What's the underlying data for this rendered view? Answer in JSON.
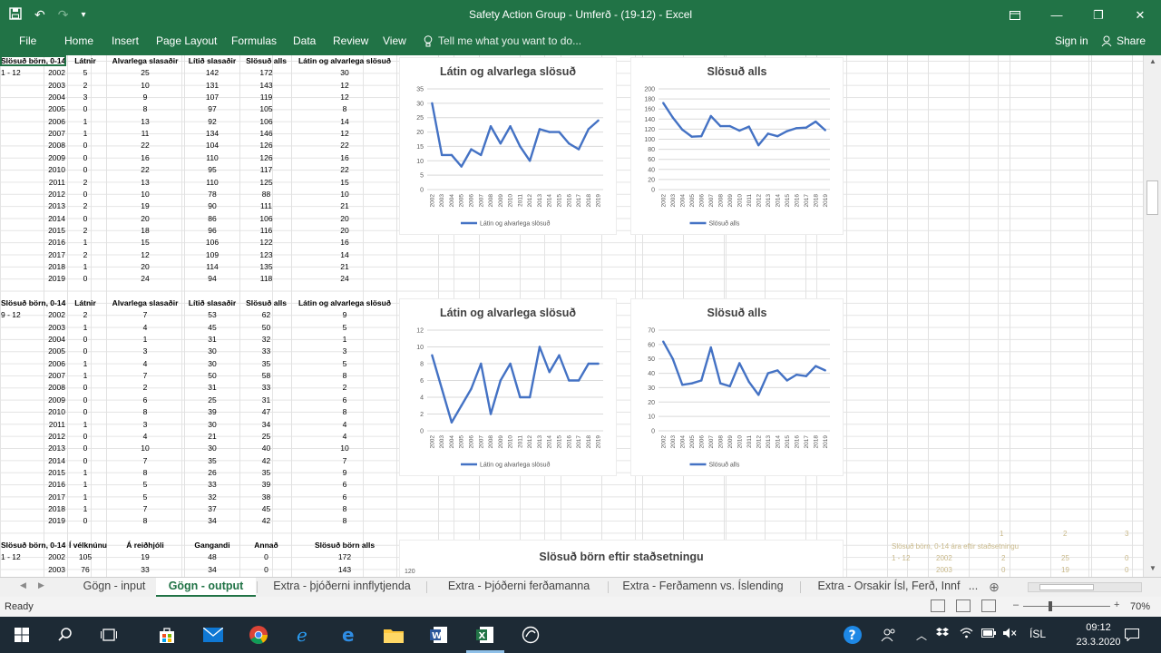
{
  "window": {
    "title": "Safety Action Group - Umferð - (19-12) - Excel",
    "minimize": "—",
    "restore": "❐",
    "close": "✕"
  },
  "qat": {
    "save": "💾",
    "undo": "↶",
    "redo": "↷",
    "more": "▾"
  },
  "ribbon": {
    "tabs": [
      "File",
      "Home",
      "Insert",
      "Page Layout",
      "Formulas",
      "Data",
      "Review",
      "View"
    ],
    "tell_me": "Tell me what you want to do...",
    "sign_in": "Sign in",
    "share": "Share"
  },
  "tables": [
    {
      "headers": [
        "Slösuð börn, 0-14",
        "",
        "Látnir",
        "Alvarlega slasaðir",
        "Lítið slasaðir",
        "Slösuð alls",
        "Látin og alvarlega slösuð"
      ],
      "age": "1 - 12",
      "rows": [
        [
          "2002",
          "5",
          "25",
          "142",
          "172",
          "30"
        ],
        [
          "2003",
          "2",
          "10",
          "131",
          "143",
          "12"
        ],
        [
          "2004",
          "3",
          "9",
          "107",
          "119",
          "12"
        ],
        [
          "2005",
          "0",
          "8",
          "97",
          "105",
          "8"
        ],
        [
          "2006",
          "1",
          "13",
          "92",
          "106",
          "14"
        ],
        [
          "2007",
          "1",
          "11",
          "134",
          "146",
          "12"
        ],
        [
          "2008",
          "0",
          "22",
          "104",
          "126",
          "22"
        ],
        [
          "2009",
          "0",
          "16",
          "110",
          "126",
          "16"
        ],
        [
          "2010",
          "0",
          "22",
          "95",
          "117",
          "22"
        ],
        [
          "2011",
          "2",
          "13",
          "110",
          "125",
          "15"
        ],
        [
          "2012",
          "0",
          "10",
          "78",
          "88",
          "10"
        ],
        [
          "2013",
          "2",
          "19",
          "90",
          "111",
          "21"
        ],
        [
          "2014",
          "0",
          "20",
          "86",
          "106",
          "20"
        ],
        [
          "2015",
          "2",
          "18",
          "96",
          "116",
          "20"
        ],
        [
          "2016",
          "1",
          "15",
          "106",
          "122",
          "16"
        ],
        [
          "2017",
          "2",
          "12",
          "109",
          "123",
          "14"
        ],
        [
          "2018",
          "1",
          "20",
          "114",
          "135",
          "21"
        ],
        [
          "2019",
          "0",
          "24",
          "94",
          "118",
          "24"
        ]
      ]
    },
    {
      "headers": [
        "Slösuð börn, 0-14",
        "",
        "Látnir",
        "Alvarlega slasaðir",
        "Lítið slasaðir",
        "Slösuð alls",
        "Látin og alvarlega slösuð"
      ],
      "age": "9 - 12",
      "rows": [
        [
          "2002",
          "2",
          "7",
          "53",
          "62",
          "9"
        ],
        [
          "2003",
          "1",
          "4",
          "45",
          "50",
          "5"
        ],
        [
          "2004",
          "0",
          "1",
          "31",
          "32",
          "1"
        ],
        [
          "2005",
          "0",
          "3",
          "30",
          "33",
          "3"
        ],
        [
          "2006",
          "1",
          "4",
          "30",
          "35",
          "5"
        ],
        [
          "2007",
          "1",
          "7",
          "50",
          "58",
          "8"
        ],
        [
          "2008",
          "0",
          "2",
          "31",
          "33",
          "2"
        ],
        [
          "2009",
          "0",
          "6",
          "25",
          "31",
          "6"
        ],
        [
          "2010",
          "0",
          "8",
          "39",
          "47",
          "8"
        ],
        [
          "2011",
          "1",
          "3",
          "30",
          "34",
          "4"
        ],
        [
          "2012",
          "0",
          "4",
          "21",
          "25",
          "4"
        ],
        [
          "2013",
          "0",
          "10",
          "30",
          "40",
          "10"
        ],
        [
          "2014",
          "0",
          "7",
          "35",
          "42",
          "7"
        ],
        [
          "2015",
          "1",
          "8",
          "26",
          "35",
          "9"
        ],
        [
          "2016",
          "1",
          "5",
          "33",
          "39",
          "6"
        ],
        [
          "2017",
          "1",
          "5",
          "32",
          "38",
          "6"
        ],
        [
          "2018",
          "1",
          "7",
          "37",
          "45",
          "8"
        ],
        [
          "2019",
          "0",
          "8",
          "34",
          "42",
          "8"
        ]
      ]
    },
    {
      "headers": [
        "Slösuð börn, 0-14",
        "Í vélknúnu",
        "Á reiðhjóli",
        "Gangandi",
        "Annað",
        "Slösuð börn alls"
      ],
      "age": "1 - 12",
      "rows": [
        [
          "2002",
          "105",
          "19",
          "48",
          "0",
          "172"
        ],
        [
          "2003",
          "76",
          "33",
          "34",
          "0",
          "143"
        ]
      ]
    }
  ],
  "chart_data": [
    {
      "type": "line",
      "title": "Látin og alvarlega slösuð",
      "x": [
        "2002",
        "2003",
        "2004",
        "2005",
        "2006",
        "2007",
        "2008",
        "2009",
        "2010",
        "2011",
        "2012",
        "2013",
        "2014",
        "2015",
        "2016",
        "2017",
        "2018",
        "2019"
      ],
      "series": [
        {
          "name": "Látin og alvarlega slösuð",
          "values": [
            30,
            12,
            12,
            8,
            14,
            12,
            22,
            16,
            22,
            15,
            10,
            21,
            20,
            20,
            16,
            14,
            21,
            24
          ]
        }
      ],
      "ylim": [
        0,
        35
      ],
      "yticks": [
        0,
        5,
        10,
        15,
        20,
        25,
        30,
        35
      ],
      "grid": true,
      "legend": "bottom",
      "color": "#4472c4"
    },
    {
      "type": "line",
      "title": "Slösuð alls",
      "x": [
        "2002",
        "2003",
        "2004",
        "2005",
        "2006",
        "2007",
        "2008",
        "2009",
        "2010",
        "2011",
        "2012",
        "2013",
        "2014",
        "2015",
        "2016",
        "2017",
        "2018",
        "2019"
      ],
      "series": [
        {
          "name": "Slösuð alls",
          "values": [
            172,
            143,
            119,
            105,
            106,
            146,
            126,
            126,
            117,
            125,
            88,
            111,
            106,
            116,
            122,
            123,
            135,
            118
          ]
        }
      ],
      "ylim": [
        0,
        200
      ],
      "yticks": [
        0,
        20,
        40,
        60,
        80,
        100,
        120,
        140,
        160,
        180,
        200
      ],
      "grid": true,
      "legend": "bottom",
      "color": "#4472c4"
    },
    {
      "type": "line",
      "title": "Látin og alvarlega slösuð",
      "x": [
        "2002",
        "2003",
        "2004",
        "2005",
        "2006",
        "2007",
        "2008",
        "2009",
        "2010",
        "2011",
        "2012",
        "2013",
        "2014",
        "2015",
        "2016",
        "2017",
        "2018",
        "2019"
      ],
      "series": [
        {
          "name": "Látin og alvarlega slösuð",
          "values": [
            9,
            5,
            1,
            3,
            5,
            8,
            2,
            6,
            8,
            4,
            4,
            10,
            7,
            9,
            6,
            6,
            8,
            8
          ]
        }
      ],
      "ylim": [
        0,
        12
      ],
      "yticks": [
        0,
        2,
        4,
        6,
        8,
        10,
        12
      ],
      "grid": true,
      "legend": "bottom",
      "color": "#4472c4"
    },
    {
      "type": "line",
      "title": "Slösuð alls",
      "x": [
        "2002",
        "2003",
        "2004",
        "2005",
        "2006",
        "2007",
        "2008",
        "2009",
        "2010",
        "2011",
        "2012",
        "2013",
        "2014",
        "2015",
        "2016",
        "2017",
        "2018",
        "2019"
      ],
      "series": [
        {
          "name": "Slösuð alls",
          "values": [
            62,
            50,
            32,
            33,
            35,
            58,
            33,
            31,
            47,
            34,
            25,
            40,
            42,
            35,
            39,
            38,
            45,
            42
          ]
        }
      ],
      "ylim": [
        0,
        70
      ],
      "yticks": [
        0,
        10,
        20,
        30,
        40,
        50,
        60,
        70
      ],
      "grid": true,
      "legend": "bottom",
      "color": "#4472c4"
    }
  ],
  "bottom_chart": {
    "title": "Slösuð börn eftir staðsetningu",
    "ytick": "120"
  },
  "faint_table": {
    "header_nums": [
      "1",
      "2",
      "3"
    ],
    "title": "Slösuð börn, 0-14 ára eftir staðsetningu",
    "row1": [
      "1 - 12",
      "2002",
      "2",
      "25",
      "0"
    ],
    "row2": [
      "2003",
      "0",
      "19",
      "0"
    ]
  },
  "sheet_tabs": [
    "Gögn - input",
    "Gögn - output",
    "Extra - þjóðerni innflytjenda",
    "Extra - Þjóðerni ferðamanna",
    "Extra - Ferðamenn vs. Íslending",
    "Extra - Orsakir Ísl, Ferð, Innf",
    "..."
  ],
  "active_sheet": "Gögn - output",
  "status": {
    "ready": "Ready",
    "zoom": "70%",
    "minus": "–",
    "plus": "+"
  },
  "taskbar": {
    "time": "09:12",
    "date": "23.3.2020",
    "lang": "ÍSL"
  }
}
